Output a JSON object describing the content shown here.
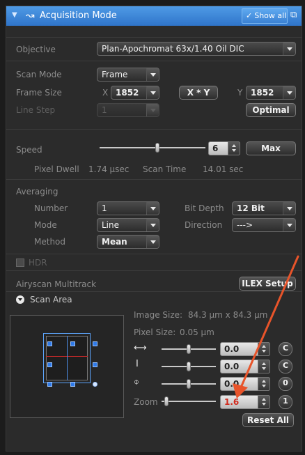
{
  "panel": {
    "title": "Acquisition Mode",
    "show_all_label": "Show all",
    "icons": [
      "chevron-down-icon",
      "acquisition-mode-icon",
      "check-icon",
      "popout-icon"
    ]
  },
  "objective": {
    "label": "Objective",
    "value": "Plan-Apochromat 63x/1.40 Oil DIC"
  },
  "scan_mode": {
    "label": "Scan Mode",
    "value": "Frame"
  },
  "frame_size": {
    "label": "Frame Size",
    "x_label": "X",
    "x_value": "1852",
    "xy_button": "X * Y",
    "y_label": "Y",
    "y_value": "1852"
  },
  "line_step": {
    "label": "Line Step",
    "value": "1",
    "optimal_button": "Optimal"
  },
  "speed": {
    "label": "Speed",
    "value": "6",
    "max_button": "Max",
    "slider_fraction": 0.55
  },
  "dwell": {
    "pixel_dwell_label": "Pixel Dwell",
    "pixel_dwell_value": "1.74 µsec",
    "scan_time_label": "Scan Time",
    "scan_time_value": "14.01 sec"
  },
  "averaging": {
    "label": "Averaging",
    "number_label": "Number",
    "number_value": "1",
    "bit_depth_label": "Bit Depth",
    "bit_depth_value": "12 Bit",
    "mode_label": "Mode",
    "mode_value": "Line",
    "direction_label": "Direction",
    "direction_value": "--->",
    "method_label": "Method",
    "method_value": "Mean"
  },
  "hdr": {
    "label": "HDR",
    "checked": false
  },
  "airyscan": {
    "label": "Airyscan Multitrack",
    "ilex_button": "ILEX Setup"
  },
  "scan_area": {
    "header": "Scan Area",
    "image_size_label": "Image Size:",
    "image_size_value": "84.3  µm x 84.3  µm",
    "pixel_size_label": "Pixel Size:",
    "pixel_size_value": "0.05 µm",
    "offset_x_value": "0.0",
    "offset_x_reset": "C",
    "offset_y_value": "0.0",
    "offset_y_reset": "C",
    "rotation_value": "0.0",
    "rotation_reset": "0",
    "zoom_label": "Zoom",
    "zoom_value": "1.6",
    "zoom_reset": "1",
    "reset_all_button": "Reset All",
    "icons": [
      "offset-x-icon",
      "offset-y-icon",
      "rotation-icon"
    ]
  },
  "annotation": {
    "arrow_color": "#e8542a"
  }
}
